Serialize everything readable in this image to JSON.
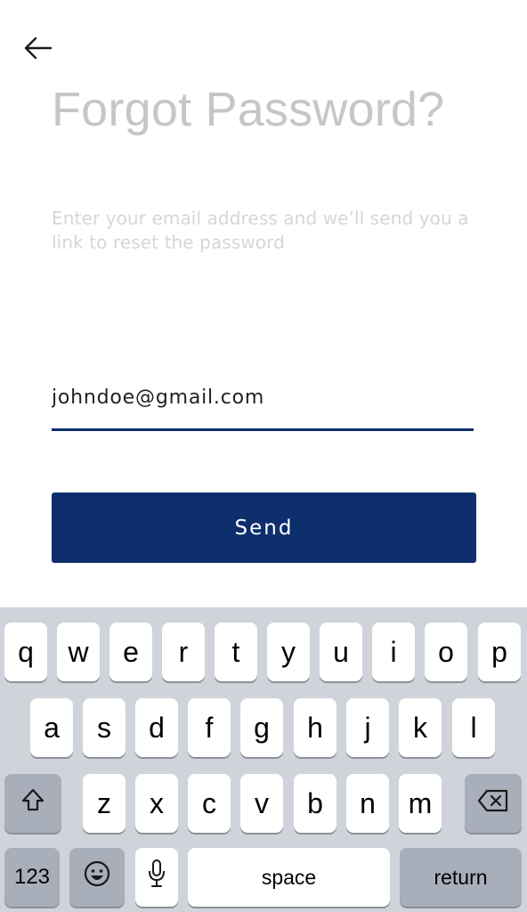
{
  "header": {
    "title": "Forgot Password?",
    "subtitle": "Enter your email address and we’ll send you a link to reset the password"
  },
  "form": {
    "email_value": "johndoe@gmail.com",
    "send_label": "Send"
  },
  "keyboard": {
    "row1": [
      "q",
      "w",
      "e",
      "r",
      "t",
      "y",
      "u",
      "i",
      "o",
      "p"
    ],
    "row2": [
      "a",
      "s",
      "d",
      "f",
      "g",
      "h",
      "j",
      "k",
      "l"
    ],
    "row3": [
      "z",
      "x",
      "c",
      "v",
      "b",
      "n",
      "m"
    ],
    "num_label": "123",
    "space_label": "space",
    "return_label": "return"
  },
  "colors": {
    "accent": "#0d2f6b",
    "keyboard_bg": "#cfd3da"
  },
  "icons": {
    "back": "arrow-left-icon",
    "shift": "shift-icon",
    "delete": "backspace-icon",
    "emoji": "emoji-icon",
    "mic": "microphone-icon"
  }
}
